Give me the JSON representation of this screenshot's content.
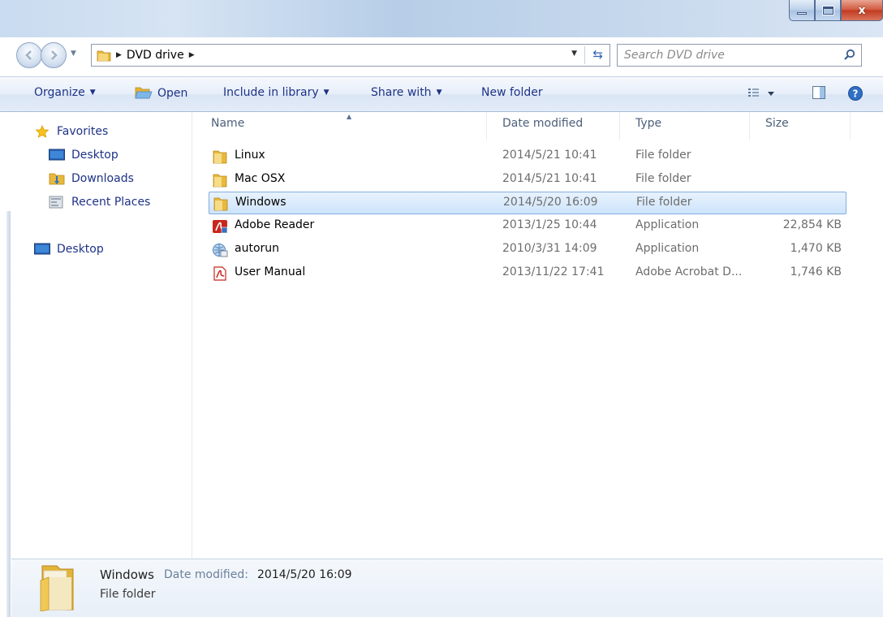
{
  "window": {
    "controls": {
      "minimize_icon": "minimize-icon",
      "maximize_icon": "maximize-icon",
      "close_glyph": "x"
    }
  },
  "address": {
    "path_segments": [
      "DVD drive"
    ],
    "search_placeholder": "Search DVD drive"
  },
  "toolbar": {
    "organize": "Organize",
    "open": "Open",
    "include_in_library": "Include in library",
    "share_with": "Share with",
    "new_folder": "New folder"
  },
  "nav": {
    "favorites": "Favorites",
    "desktop": "Desktop",
    "downloads": "Downloads",
    "recent_places": "Recent Places",
    "desktop_root": "Desktop"
  },
  "columns": {
    "name": "Name",
    "date_modified": "Date modified",
    "type": "Type",
    "size": "Size"
  },
  "files": [
    {
      "name": "Linux",
      "date": "2014/5/21 10:41",
      "type": "File folder",
      "size": "",
      "icon": "folder-icon"
    },
    {
      "name": "Mac OSX",
      "date": "2014/5/21 10:41",
      "type": "File folder",
      "size": "",
      "icon": "folder-icon"
    },
    {
      "name": "Windows",
      "date": "2014/5/20 16:09",
      "type": "File folder",
      "size": "",
      "icon": "folder-icon",
      "selected": true
    },
    {
      "name": "Adobe Reader",
      "date": "2013/1/25 10:44",
      "type": "Application",
      "size": "22,854 KB",
      "icon": "adobe-reader-icon"
    },
    {
      "name": "autorun",
      "date": "2010/3/31 14:09",
      "type": "Application",
      "size": "1,470 KB",
      "icon": "autorun-icon"
    },
    {
      "name": "User Manual",
      "date": "2013/11/22 17:41",
      "type": "Adobe Acrobat D...",
      "size": "1,746 KB",
      "icon": "pdf-icon"
    }
  ],
  "details": {
    "name": "Windows",
    "date_label": "Date modified:",
    "date_value": "2014/5/20 16:09",
    "type": "File folder"
  },
  "colors": {
    "link_blue": "#1e3287",
    "selection_border": "#84acdd",
    "selection_fill": "#cde4fb",
    "folder_yellow": "#e8b93a"
  }
}
